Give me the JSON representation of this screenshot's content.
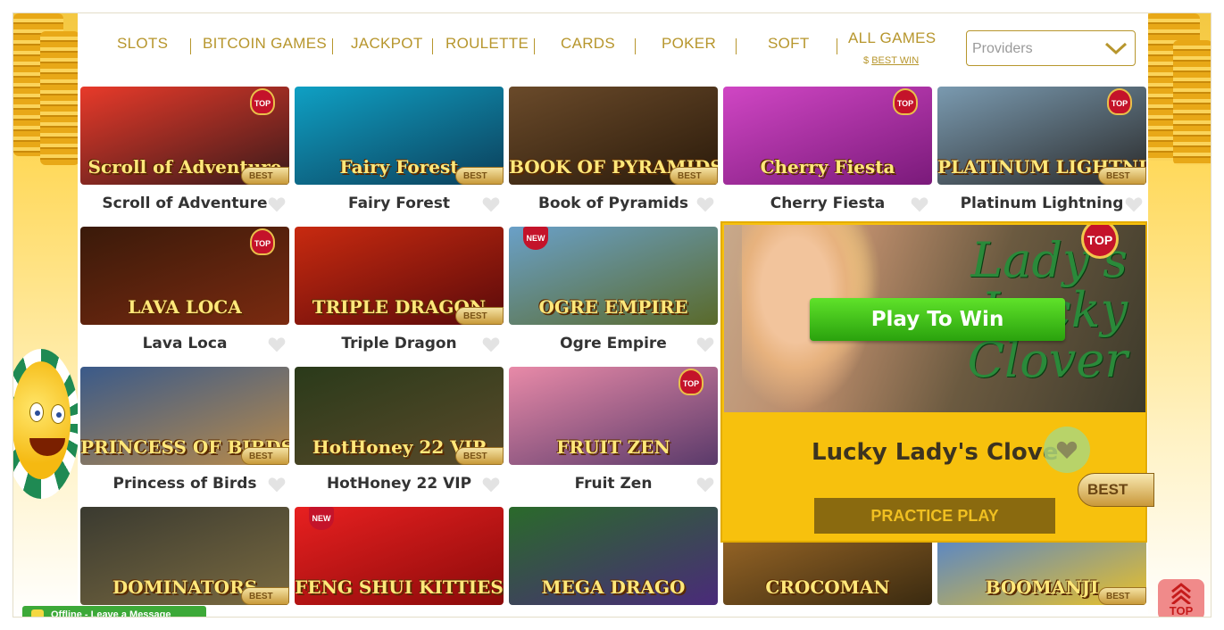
{
  "nav": {
    "items": [
      {
        "label": "SLOTS"
      },
      {
        "label": "BITCOIN GAMES"
      },
      {
        "label": "JACKPOT"
      },
      {
        "label": "ROULETTE"
      },
      {
        "label": "CARDS"
      },
      {
        "label": "POKER"
      },
      {
        "label": "SOFT"
      },
      {
        "label": "ALL GAMES"
      }
    ],
    "best_win_prefix": "$",
    "best_win_label": "BEST WIN",
    "providers_placeholder": "Providers"
  },
  "games": [
    {
      "name": "Scroll of Adventure",
      "art_text": "Scroll of Adventure",
      "badges": [
        "TOP",
        "BEST"
      ],
      "colors": [
        "#e83a2a",
        "#3a1a1a"
      ]
    },
    {
      "name": "Fairy Forest",
      "art_text": "Fairy Forest",
      "badges": [
        "BEST"
      ],
      "colors": [
        "#0fa0c4",
        "#0c3f5a"
      ]
    },
    {
      "name": "Book of Pyramids",
      "art_text": "BOOK OF PYRAMIDS",
      "badges": [
        "BEST"
      ],
      "colors": [
        "#6a4a2a",
        "#2a1a0a"
      ]
    },
    {
      "name": "Cherry Fiesta",
      "art_text": "Cherry Fiesta",
      "badges": [
        "TOP"
      ],
      "colors": [
        "#d046c4",
        "#7a1a7a"
      ]
    },
    {
      "name": "Platinum Lightning",
      "art_text": "PLATINUM LIGHTNING",
      "badges": [
        "TOP",
        "BEST"
      ],
      "colors": [
        "#7a9ab0",
        "#2a2a2a"
      ]
    },
    {
      "name": "Lava Loca",
      "art_text": "LAVA LOCA",
      "badges": [
        "TOP"
      ],
      "colors": [
        "#3a1a0a",
        "#7a2a10"
      ]
    },
    {
      "name": "Triple Dragon",
      "art_text": "TRIPLE DRAGON",
      "badges": [
        "BEST"
      ],
      "colors": [
        "#c82a10",
        "#5a0a0a"
      ]
    },
    {
      "name": "Ogre Empire",
      "art_text": "OGRE EMPIRE",
      "badges": [
        "NEW"
      ],
      "colors": [
        "#6aa0c8",
        "#5a6a2a"
      ]
    },
    {
      "name": "Princess of Birds",
      "art_text": "PRINCESS OF BIRDS",
      "badges": [
        "BEST"
      ],
      "colors": [
        "#3a5a8a",
        "#b88a4a"
      ]
    },
    {
      "name": "HotHoney 22 VIP",
      "art_text": "HotHoney 22 VIP",
      "badges": [
        "BEST"
      ],
      "colors": [
        "#2a3a1a",
        "#5a4a2a"
      ]
    },
    {
      "name": "Fruit Zen",
      "art_text": "FRUIT ZEN",
      "badges": [
        "TOP"
      ],
      "colors": [
        "#e88aa8",
        "#5a3a6a"
      ]
    },
    {
      "name": "",
      "art_text": "DOMINATORS",
      "badges": [
        "BEST"
      ],
      "colors": [
        "#3a3a30",
        "#7a6a40"
      ]
    },
    {
      "name": "",
      "art_text": "FENG SHUI KITTIES",
      "badges": [
        "NEW"
      ],
      "colors": [
        "#e82020",
        "#8a0a0a"
      ]
    },
    {
      "name": "",
      "art_text": "MEGA DRAGO",
      "badges": [],
      "colors": [
        "#2a6a2a",
        "#4a2a7a"
      ]
    },
    {
      "name": "",
      "art_text": "CROCOMAN",
      "badges": [],
      "colors": [
        "#a8702a",
        "#3a2a10"
      ]
    },
    {
      "name": "",
      "art_text": "BOOMANJI",
      "badges": [
        "BEST"
      ],
      "colors": [
        "#3a7ae8",
        "#e8c02a"
      ]
    }
  ],
  "feature": {
    "logo_text": "Lady's Lucky Clover",
    "play_label": "Play To Win",
    "badge_top": "TOP",
    "title": "Lucky Lady's Clove",
    "best_label": "BEST",
    "practice_label": "PRACTICE PLAY"
  },
  "chat": {
    "label": "Offline - Leave a Message"
  },
  "scroll_top": {
    "label": "TOP"
  },
  "colors": {
    "accent_gold": "#b7962d",
    "feature_bg": "#f7c10d",
    "play_green": "#3ec418"
  }
}
